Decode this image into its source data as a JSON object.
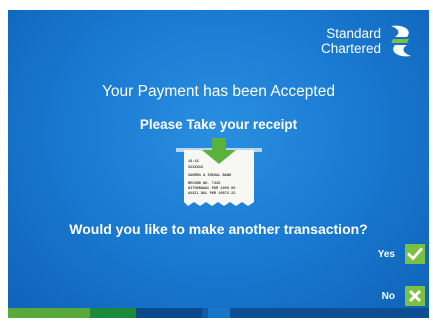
{
  "brand": {
    "line1": "Standard",
    "line2": "Chartered",
    "logo_icon": "standard-chartered-logo"
  },
  "message": {
    "title": "Your Payment has been Accepted",
    "subtitle": "Please Take  your receipt",
    "question": "Would you like to make another transaction?"
  },
  "options": {
    "yes_label": "Yes",
    "no_label": "No",
    "yes_icon": "check-icon",
    "no_icon": "cross-icon"
  },
  "receipt": {
    "lines": [
      "18:42",
      "XXXXXXX",
      "SAHREA & INSUAL BANK",
      "RECORD NO.          7445",
      "WITHDRAWAL    PKR 1000.00",
      "AVAIL BAL     PKR 19876.22"
    ]
  },
  "colors": {
    "background": "#1a7bd2",
    "accent_green": "#7ac043",
    "footer": [
      "#58a83c",
      "#1d8a3a",
      "#0b4a8a",
      "#0f5da8",
      "#1976c6",
      "#0e4f93"
    ]
  }
}
